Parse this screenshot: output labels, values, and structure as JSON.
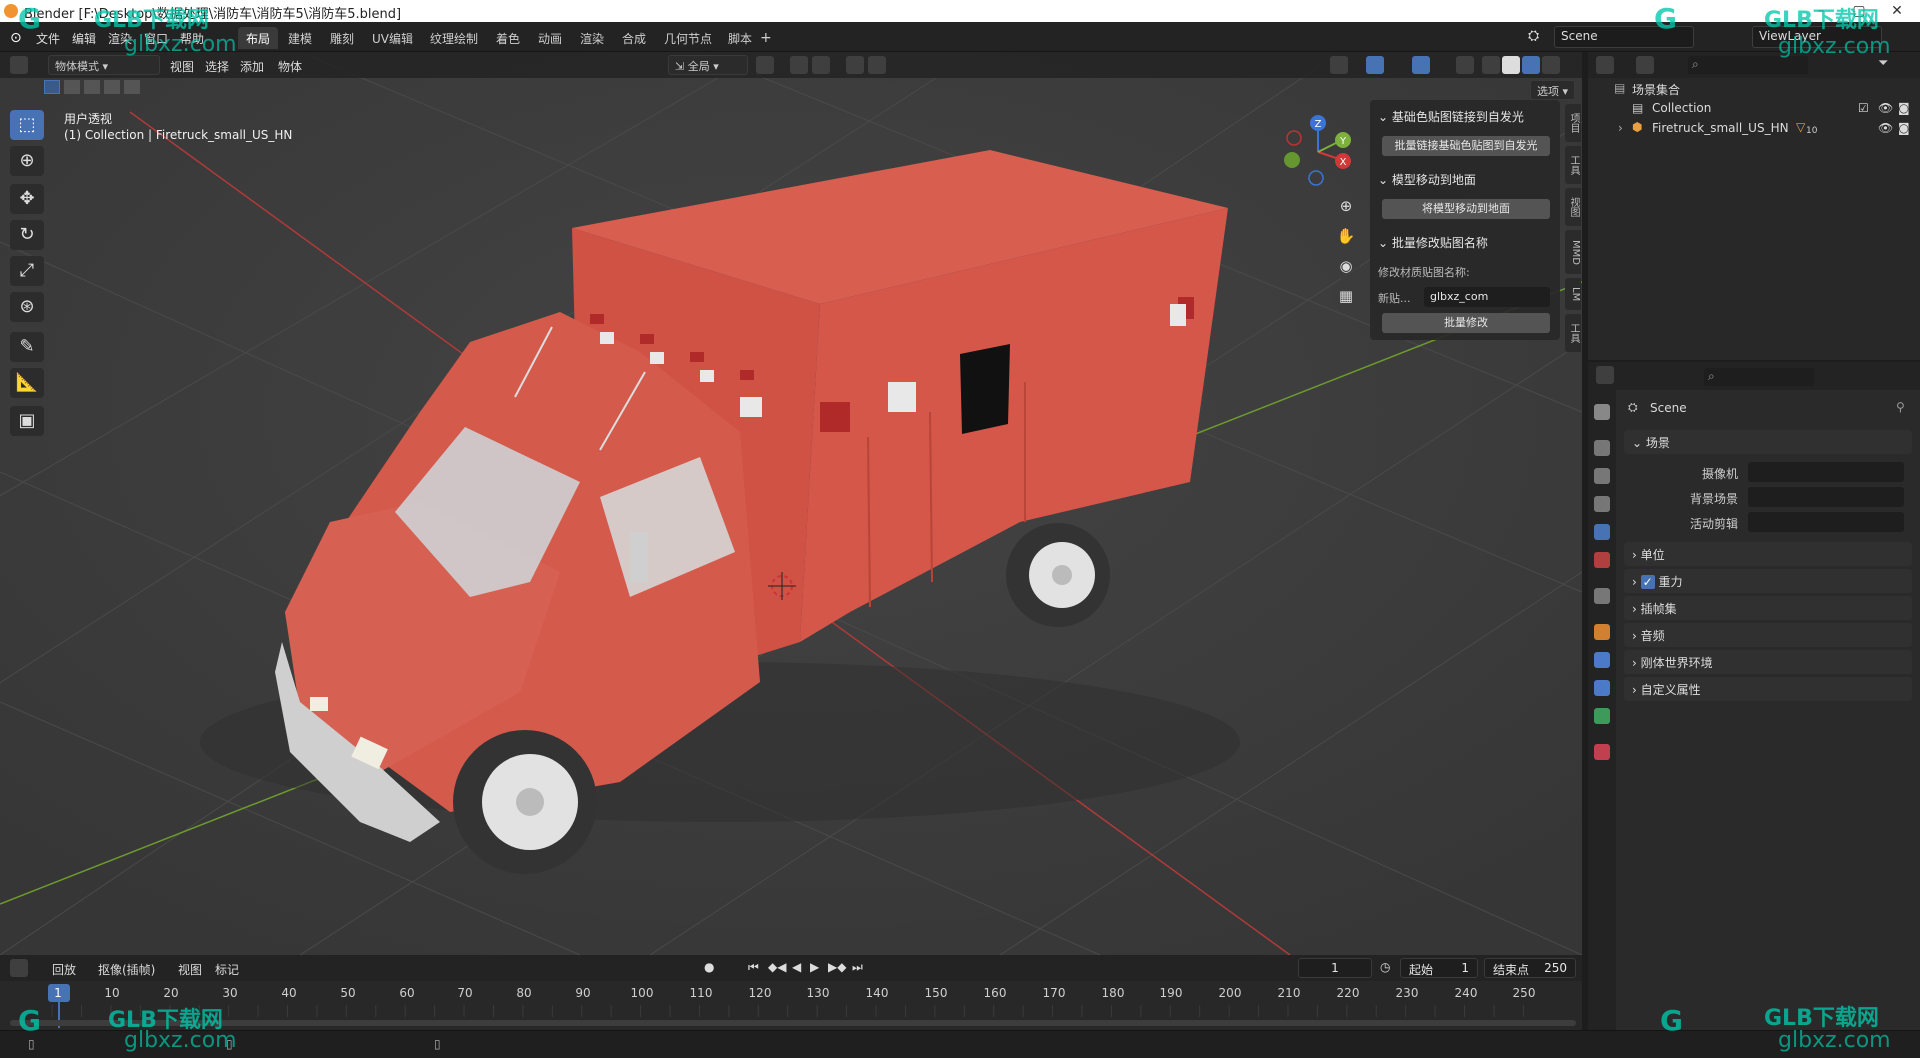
{
  "window": {
    "title": "Blender [F:\\Desktop\\数据处理\\消防车\\消防车5\\消防车5.blend]"
  },
  "menu": {
    "items": [
      "文件",
      "编辑",
      "渲染",
      "窗口",
      "帮助"
    ]
  },
  "workspaces": {
    "tabs": [
      "布局",
      "建模",
      "雕刻",
      "UV编辑",
      "纹理绘制",
      "着色",
      "动画",
      "渲染",
      "合成",
      "几何节点",
      "脚本"
    ],
    "active": "布局",
    "add": "+"
  },
  "scene_selector": {
    "value": "Scene"
  },
  "viewlayer_selector": {
    "value": "ViewLayer"
  },
  "viewport_header": {
    "mode": "物体模式",
    "menus": [
      "视图",
      "选择",
      "添加",
      "物体"
    ],
    "orientation": "全局",
    "options": "选项"
  },
  "viewport": {
    "view_name": "用户透视",
    "collection_info": "(1) Collection | Firetruck_small_US_HN",
    "gizmo": {
      "x": "X",
      "y": "Y",
      "z": "Z"
    },
    "colors": {
      "truck_body": "#d9574a",
      "truck_trim": "#c9c9c9",
      "grid": "#3a3a3a",
      "x_axis": "#c04040",
      "y_axis": "#7aa63a"
    }
  },
  "npanel": {
    "section1_title": "基础色贴图链接到自发光",
    "section1_button": "批量链接基础色贴图到自发光",
    "section2_title": "模型移动到地面",
    "section2_button": "将模型移动到地面",
    "section3_title": "批量修改贴图名称",
    "rename_label": "修改材质贴图名称:",
    "new_label": "新贴...",
    "new_value": "glbxz_com",
    "rename_button": "批量修改",
    "side_tabs": [
      "项目",
      "工具",
      "视图",
      "MMD",
      "LM",
      "工具"
    ]
  },
  "outliner": {
    "root": "场景集合",
    "rows": [
      {
        "label": "Collection",
        "badge": ""
      },
      {
        "label": "Firetruck_small_US_HN",
        "badge": "10"
      }
    ]
  },
  "properties": {
    "scene_name": "Scene",
    "scene_section": "场景",
    "fields": [
      {
        "label": "摄像机",
        "value": ""
      },
      {
        "label": "背景场景",
        "value": ""
      },
      {
        "label": "活动剪辑",
        "value": ""
      }
    ],
    "sections": [
      "单位",
      "重力",
      "插帧集",
      "音频",
      "刚体世界环境",
      "自定义属性"
    ],
    "gravity_checked": true
  },
  "timeline": {
    "menus": [
      "回放",
      "抠像(插帧)",
      "视图",
      "标记"
    ],
    "current_frame": "1",
    "start_label": "起始",
    "start_value": "1",
    "end_label": "结束点",
    "end_value": "250",
    "ticks": [
      "1",
      "10",
      "20",
      "30",
      "40",
      "50",
      "60",
      "70",
      "80",
      "90",
      "100",
      "110",
      "120",
      "130",
      "140",
      "150",
      "160",
      "170",
      "180",
      "190",
      "200",
      "210",
      "220",
      "230",
      "240",
      "250"
    ]
  },
  "watermark": {
    "logo_text": "GLB下载网",
    "site": "glbxz.com",
    "site_alt": "glbxz.com"
  }
}
